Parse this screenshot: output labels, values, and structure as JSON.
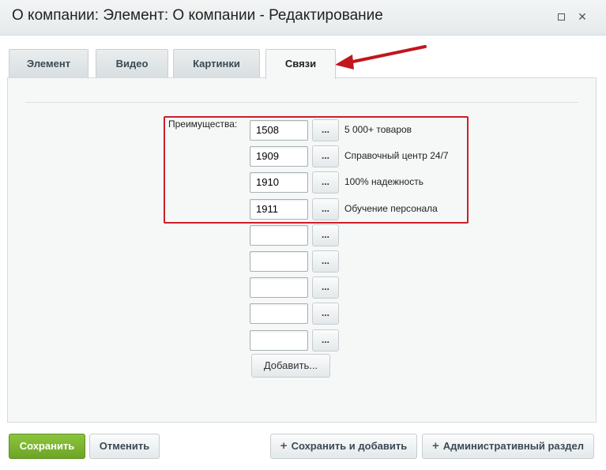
{
  "window": {
    "title": "О компании: Элемент: О компании - Редактирование"
  },
  "tabs": [
    {
      "label": "Элемент",
      "active": false
    },
    {
      "label": "Видео",
      "active": false
    },
    {
      "label": "Картинки",
      "active": false
    },
    {
      "label": "Связи",
      "active": true
    }
  ],
  "form": {
    "field_label": "Преимущества:",
    "rows": [
      {
        "value": "1508",
        "button": "...",
        "description": "5 000+ товаров"
      },
      {
        "value": "1909",
        "button": "...",
        "description": "Справочный центр 24/7"
      },
      {
        "value": "1910",
        "button": "...",
        "description": "100% надежность"
      },
      {
        "value": "1911",
        "button": "...",
        "description": "Обучение персонала"
      },
      {
        "value": "",
        "button": "...",
        "description": ""
      },
      {
        "value": "",
        "button": "...",
        "description": ""
      },
      {
        "value": "",
        "button": "...",
        "description": ""
      },
      {
        "value": "",
        "button": "...",
        "description": ""
      },
      {
        "value": "",
        "button": "...",
        "description": ""
      }
    ],
    "add_button": "Добавить..."
  },
  "footer": {
    "save": "Сохранить",
    "cancel": "Отменить",
    "save_and_add": "Сохранить и добавить",
    "admin_section": "Административный раздел"
  },
  "colors": {
    "highlight": "#cc1f27",
    "save_button": "#7bb332",
    "annotation_arrow": "#c0161d"
  },
  "icons": {
    "maximize": "maximize-icon",
    "close": "close-icon",
    "plus": "plus-icon",
    "annotation_arrow": "red-arrow-icon"
  }
}
